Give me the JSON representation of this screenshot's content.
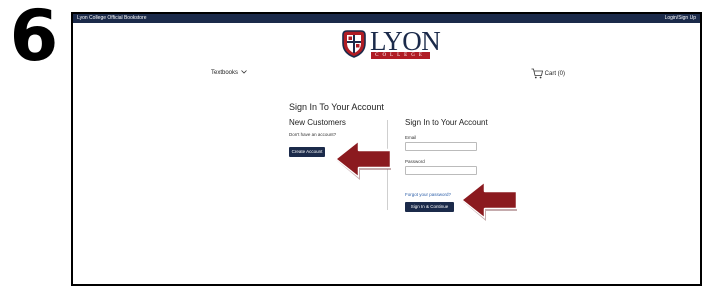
{
  "step_number": "6",
  "topbar": {
    "store_name": "Lyon College Official Bookstore",
    "login_link": "Login/Sign Up"
  },
  "logo": {
    "name": "LYON",
    "subtitle": "COLLEGE"
  },
  "nav": {
    "textbooks_label": "Textbooks",
    "cart_label": "Cart (0)"
  },
  "page": {
    "heading": "Sign In To Your Account"
  },
  "new_customers": {
    "title": "New Customers",
    "prompt": "Don't have an account?",
    "create_button": "Create Account"
  },
  "sign_in": {
    "title": "Sign In to Your Account",
    "email_label": "Email",
    "email_value": "",
    "password_label": "Password",
    "password_value": "",
    "forgot_link": "Forgot your password?",
    "submit_button": "Sign In & Continue"
  },
  "colors": {
    "navy": "#1b2a4a",
    "crimson": "#b01c24",
    "arrow": "#8b1a1f",
    "link": "#2b5ea8"
  },
  "annotations": [
    {
      "icon": "arrow-left-icon",
      "points_to": "create-account-button"
    },
    {
      "icon": "arrow-left-icon",
      "points_to": "sign-in-continue-button"
    }
  ]
}
